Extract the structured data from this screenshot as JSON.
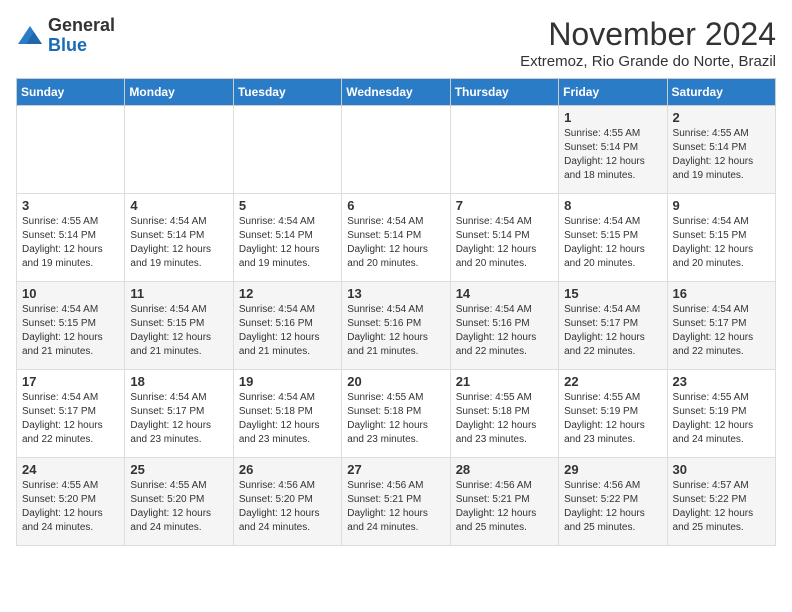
{
  "logo": {
    "general": "General",
    "blue": "Blue"
  },
  "header": {
    "title": "November 2024",
    "location": "Extremoz, Rio Grande do Norte, Brazil"
  },
  "days_of_week": [
    "Sunday",
    "Monday",
    "Tuesday",
    "Wednesday",
    "Thursday",
    "Friday",
    "Saturday"
  ],
  "weeks": [
    [
      {
        "day": "",
        "info": ""
      },
      {
        "day": "",
        "info": ""
      },
      {
        "day": "",
        "info": ""
      },
      {
        "day": "",
        "info": ""
      },
      {
        "day": "",
        "info": ""
      },
      {
        "day": "1",
        "info": "Sunrise: 4:55 AM\nSunset: 5:14 PM\nDaylight: 12 hours\nand 18 minutes."
      },
      {
        "day": "2",
        "info": "Sunrise: 4:55 AM\nSunset: 5:14 PM\nDaylight: 12 hours\nand 19 minutes."
      }
    ],
    [
      {
        "day": "3",
        "info": "Sunrise: 4:55 AM\nSunset: 5:14 PM\nDaylight: 12 hours\nand 19 minutes."
      },
      {
        "day": "4",
        "info": "Sunrise: 4:54 AM\nSunset: 5:14 PM\nDaylight: 12 hours\nand 19 minutes."
      },
      {
        "day": "5",
        "info": "Sunrise: 4:54 AM\nSunset: 5:14 PM\nDaylight: 12 hours\nand 19 minutes."
      },
      {
        "day": "6",
        "info": "Sunrise: 4:54 AM\nSunset: 5:14 PM\nDaylight: 12 hours\nand 20 minutes."
      },
      {
        "day": "7",
        "info": "Sunrise: 4:54 AM\nSunset: 5:14 PM\nDaylight: 12 hours\nand 20 minutes."
      },
      {
        "day": "8",
        "info": "Sunrise: 4:54 AM\nSunset: 5:15 PM\nDaylight: 12 hours\nand 20 minutes."
      },
      {
        "day": "9",
        "info": "Sunrise: 4:54 AM\nSunset: 5:15 PM\nDaylight: 12 hours\nand 20 minutes."
      }
    ],
    [
      {
        "day": "10",
        "info": "Sunrise: 4:54 AM\nSunset: 5:15 PM\nDaylight: 12 hours\nand 21 minutes."
      },
      {
        "day": "11",
        "info": "Sunrise: 4:54 AM\nSunset: 5:15 PM\nDaylight: 12 hours\nand 21 minutes."
      },
      {
        "day": "12",
        "info": "Sunrise: 4:54 AM\nSunset: 5:16 PM\nDaylight: 12 hours\nand 21 minutes."
      },
      {
        "day": "13",
        "info": "Sunrise: 4:54 AM\nSunset: 5:16 PM\nDaylight: 12 hours\nand 21 minutes."
      },
      {
        "day": "14",
        "info": "Sunrise: 4:54 AM\nSunset: 5:16 PM\nDaylight: 12 hours\nand 22 minutes."
      },
      {
        "day": "15",
        "info": "Sunrise: 4:54 AM\nSunset: 5:17 PM\nDaylight: 12 hours\nand 22 minutes."
      },
      {
        "day": "16",
        "info": "Sunrise: 4:54 AM\nSunset: 5:17 PM\nDaylight: 12 hours\nand 22 minutes."
      }
    ],
    [
      {
        "day": "17",
        "info": "Sunrise: 4:54 AM\nSunset: 5:17 PM\nDaylight: 12 hours\nand 22 minutes."
      },
      {
        "day": "18",
        "info": "Sunrise: 4:54 AM\nSunset: 5:17 PM\nDaylight: 12 hours\nand 23 minutes."
      },
      {
        "day": "19",
        "info": "Sunrise: 4:54 AM\nSunset: 5:18 PM\nDaylight: 12 hours\nand 23 minutes."
      },
      {
        "day": "20",
        "info": "Sunrise: 4:55 AM\nSunset: 5:18 PM\nDaylight: 12 hours\nand 23 minutes."
      },
      {
        "day": "21",
        "info": "Sunrise: 4:55 AM\nSunset: 5:18 PM\nDaylight: 12 hours\nand 23 minutes."
      },
      {
        "day": "22",
        "info": "Sunrise: 4:55 AM\nSunset: 5:19 PM\nDaylight: 12 hours\nand 23 minutes."
      },
      {
        "day": "23",
        "info": "Sunrise: 4:55 AM\nSunset: 5:19 PM\nDaylight: 12 hours\nand 24 minutes."
      }
    ],
    [
      {
        "day": "24",
        "info": "Sunrise: 4:55 AM\nSunset: 5:20 PM\nDaylight: 12 hours\nand 24 minutes."
      },
      {
        "day": "25",
        "info": "Sunrise: 4:55 AM\nSunset: 5:20 PM\nDaylight: 12 hours\nand 24 minutes."
      },
      {
        "day": "26",
        "info": "Sunrise: 4:56 AM\nSunset: 5:20 PM\nDaylight: 12 hours\nand 24 minutes."
      },
      {
        "day": "27",
        "info": "Sunrise: 4:56 AM\nSunset: 5:21 PM\nDaylight: 12 hours\nand 24 minutes."
      },
      {
        "day": "28",
        "info": "Sunrise: 4:56 AM\nSunset: 5:21 PM\nDaylight: 12 hours\nand 25 minutes."
      },
      {
        "day": "29",
        "info": "Sunrise: 4:56 AM\nSunset: 5:22 PM\nDaylight: 12 hours\nand 25 minutes."
      },
      {
        "day": "30",
        "info": "Sunrise: 4:57 AM\nSunset: 5:22 PM\nDaylight: 12 hours\nand 25 minutes."
      }
    ]
  ]
}
